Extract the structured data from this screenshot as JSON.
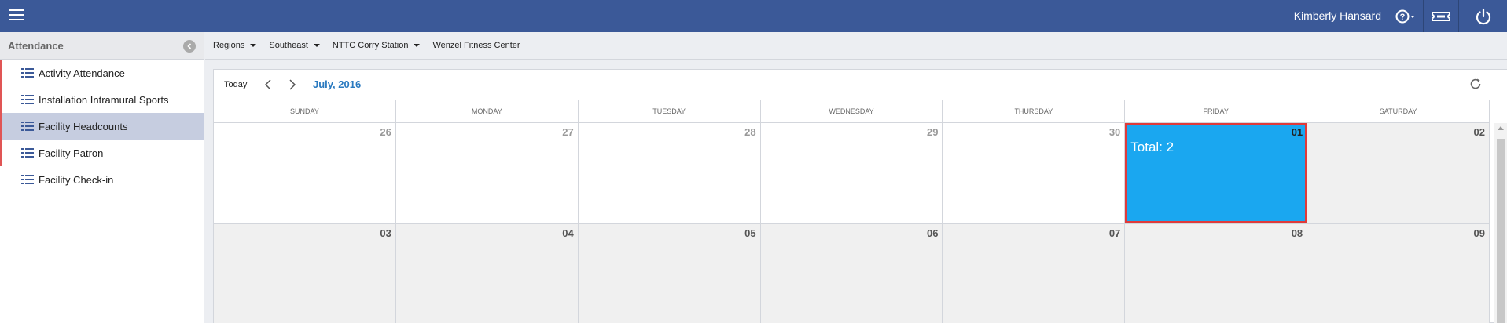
{
  "topbar": {
    "user_name": "Kimberly Hansard",
    "icons": [
      "menu-icon",
      "help-icon",
      "ticket-icon",
      "power-icon"
    ],
    "bg_color": "#3b5998"
  },
  "sidebar": {
    "title": "Attendance",
    "items": [
      {
        "label": "Activity Attendance",
        "active": false
      },
      {
        "label": "Installation Intramural Sports",
        "active": false
      },
      {
        "label": "Facility Headcounts",
        "active": true
      },
      {
        "label": "Facility Patron",
        "active": false
      },
      {
        "label": "Facility Check-in",
        "active": false
      }
    ]
  },
  "breadcrumb": {
    "items": [
      {
        "label": "Regions",
        "dropdown": true
      },
      {
        "label": "Southeast",
        "dropdown": true
      },
      {
        "label": "NTTC Corry Station",
        "dropdown": true
      },
      {
        "label": "Wenzel Fitness Center",
        "dropdown": false
      }
    ]
  },
  "calendar": {
    "today_label": "Today",
    "month_label": "July, 2016",
    "days_of_week": [
      "SUNDAY",
      "MONDAY",
      "TUESDAY",
      "WEDNESDAY",
      "THURSDAY",
      "FRIDAY",
      "SATURDAY"
    ],
    "weeks": [
      [
        {
          "num": "26",
          "muted": true
        },
        {
          "num": "27",
          "muted": true
        },
        {
          "num": "28",
          "muted": true
        },
        {
          "num": "29",
          "muted": true
        },
        {
          "num": "30",
          "muted": true
        },
        {
          "num": "01",
          "selected": true,
          "total": "Total: 2"
        },
        {
          "num": "02",
          "shaded": true
        }
      ],
      [
        {
          "num": "03",
          "shaded": true
        },
        {
          "num": "04",
          "shaded": true
        },
        {
          "num": "05",
          "shaded": true
        },
        {
          "num": "06",
          "shaded": true
        },
        {
          "num": "07",
          "shaded": true
        },
        {
          "num": "08",
          "shaded": true
        },
        {
          "num": "09",
          "shaded": true
        }
      ]
    ],
    "selected_color": "#1aa7f0",
    "highlight_border_color": "#e03a3a"
  }
}
